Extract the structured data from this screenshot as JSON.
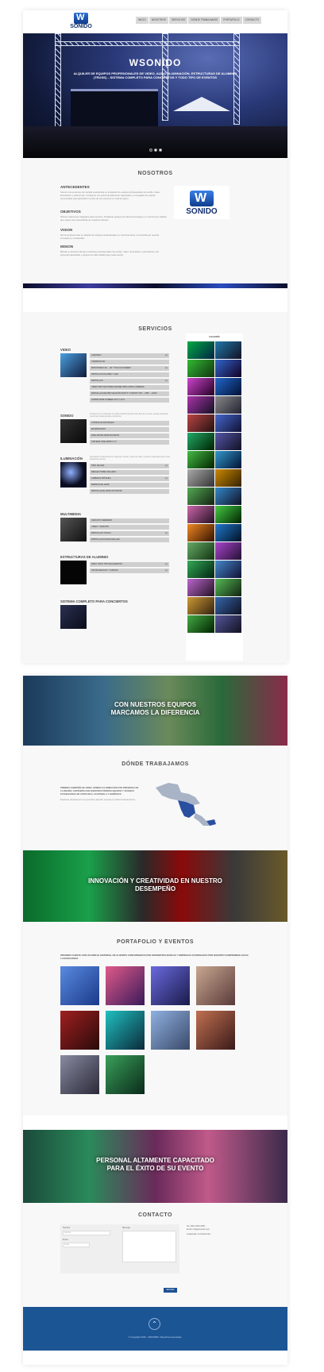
{
  "header": {
    "logo_text": "SONIDO",
    "nav": [
      "INICIO",
      "NOSOTROS",
      "SERVICIOS",
      "DÓNDE TRABAJAMOS",
      "PORTAFOLIO",
      "CONTACTO"
    ]
  },
  "hero": {
    "title": "WSONIDO",
    "subtitle": "ALQUILER DE EQUIPOS PROFESIONALES DE VIDEO, AUDIO, ILUMINACIÓN, ESTRUCTURAS DE ALUMINIO (TRUSS) – SISTEMA COMPLETO PARA CONCIERTOS Y TODO TIPO DE EVENTOS",
    "slides": 3
  },
  "nosotros": {
    "title": "NOSOTROS",
    "antecedentes_title": "ANTECEDENTES",
    "antecedentes_text": "Somos una empresa con amplia experiencia en el alquiler de equipos profesionales de sonido, video, iluminación y estructuras. Contamos con personal altamente capacitado y el respaldo de marcas reconocidas para garantizar el éxito de sus eventos en toda la región.",
    "objetivos_title": "OBJETIVOS",
    "objetivos_text": "Ofrecer soluciones integrales para eventos, brindando equipos de última tecnología y un servicio de calidad que supere las expectativas de nuestros clientes.",
    "vision_title": "VISION",
    "vision_text": "Ser la empresa líder en alquiler de equipos audiovisuales en Centroamérica, reconocida por nuestra innovación y creatividad.",
    "mision_title": "MISION",
    "mision_text": "Brindar a nuestros clientes soluciones profesionales de sonido, video, iluminación y estructuras, con personal capacitado y equipos de alta calidad para cada evento.",
    "logo_text": "SONIDO"
  },
  "servicios": {
    "title": "SERVICIOS",
    "gallery_title": "GALERÍA",
    "categories": [
      {
        "name": "VIDEO",
        "items": [
          {
            "label": "ALMANAC",
            "tag": "(+)"
          },
          {
            "label": "CÁMARAS HD",
            "tag": ""
          },
          {
            "label": "MONITORES 32\" – 46\" \"TOUCH SCREEN\"",
            "tag": "(+)"
          },
          {
            "label": "PANTALLAS PLASMA Y LED",
            "tag": ""
          },
          {
            "label": "PANTALLAS",
            "tag": "(+)"
          },
          {
            "label": "VIDEO PROYECTORES DESDE 3500 A 8000 LÚMENES",
            "tag": ""
          },
          {
            "label": "PANTALLAS DE PROYECCIÓN 6X8 FT Y FRONT 7X9\" – 9X8\" – 12X9\"",
            "tag": ""
          },
          {
            "label": "SUPER WIDE SCREEN 16:9 Y 32:9",
            "tag": ""
          }
        ]
      },
      {
        "name": "SONIDO",
        "desc": "Contamos con sistemas de audio profesional para todo tipo de eventos, desde pequeñas reuniones hasta grandes conciertos.",
        "items": [
          {
            "label": "CONSOLAS DIGITALES",
            "tag": ""
          },
          {
            "label": "MICRÓFONOS",
            "tag": ""
          },
          {
            "label": "PARLANTES AMPLIFICADOS",
            "tag": ""
          },
          {
            "label": "SISTEMA LINE ARRAY 2.0",
            "tag": ""
          }
        ]
      },
      {
        "name": "ILUMINACIÓN",
        "desc": "Iluminación profesional con cabezas móviles, pisos de LED y efectos especiales para crear ambientes únicos.",
        "items": [
          {
            "label": "PISO DE LED",
            "tag": "(+)"
          },
          {
            "label": "REFLECTORES DE LEDS",
            "tag": ""
          },
          {
            "label": "CABEZAS MÓVILES",
            "tag": "(+)"
          },
          {
            "label": "BARRAS DE LEDS",
            "tag": ""
          },
          {
            "label": "PANTALLA DE LEDS OUTDOOR",
            "tag": ""
          }
        ]
      },
      {
        "name": "MULTIMEDIA",
        "items": [
          {
            "label": "CIRCUITO CERRADO",
            "tag": ""
          },
          {
            "label": "VIDEO Y EDICIÓN",
            "tag": ""
          },
          {
            "label": "PANTALLAS TOUCH",
            "tag": "(+)"
          },
          {
            "label": "PANTALLAS PLANAS DE LED",
            "tag": ""
          }
        ]
      },
      {
        "name": "ESTRUCTURAS DE ALUMINIO",
        "items": [
          {
            "label": "PARA TODO TIPO DE EVENTOS",
            "tag": "(+)"
          },
          {
            "label": "TRUSS RECTAS Y CURVAS",
            "tag": "(+)"
          }
        ]
      },
      {
        "name": "SISTEMA COMPLETO PARA CONCIERTOS",
        "items": []
      }
    ]
  },
  "bands": {
    "band1": "CON NUESTROS EQUIPOS MARCAMOS LA DIFERENCIA",
    "band2": "INNOVACIÓN Y CREATIVIDAD EN NUESTRO DESEMPEÑO",
    "band3": "PERSONAL ALTAMENTE CAPACITADO PARA EL ÉXITO DE SU EVENTO"
  },
  "donde": {
    "title": "DÓNDE TRABAJAMOS",
    "text": "PRIMERA COMPAÑÍA DE VIDEO, SONIDO E ILUMINACIÓN CON PRESENCIA EN LA REGIÓN. CONTAMOS CON NUESTROS PROPIOS EQUIPOS Y OFICINAS ESTABLECIDAS EN COSTA RICA, GUATEMALA Y HONDURAS.",
    "subtext": "Nuestras ubicaciones nos permiten atender eventos en toda Centroamérica."
  },
  "portafolio": {
    "title": "PORTAFOLIO Y EVENTOS",
    "text": "WSONIDO CUENTA CON UN AMPLIO HISTORIAL DE CLIENTES CONFORMADOS POR DIFERENTES MARCAS Y EMPRESAS SATISFECHOS POR NUESTRO COMPROMISO HACIA LA EXCELENCIA"
  },
  "contacto": {
    "title": "CONTACTO",
    "label_nombre": "Nombre",
    "ph_nombre": "Nombre",
    "label_email": "Email",
    "ph_email": "Email",
    "label_mensaje": "Mensaje",
    "button": "ENVIAR",
    "tel": "Tel: (502) 2333-4455",
    "email": "Email: info@wsonido.com",
    "address": "Guatemala, Centroamérica"
  },
  "footer": {
    "up": "⌃",
    "copyright": "© Copyright 2015 – WSONIDO. Derechos reservados."
  },
  "colors": {
    "footer_bg": "#1c5594",
    "accent": "#1b4f92",
    "item_bg": "#cfcfcf"
  }
}
